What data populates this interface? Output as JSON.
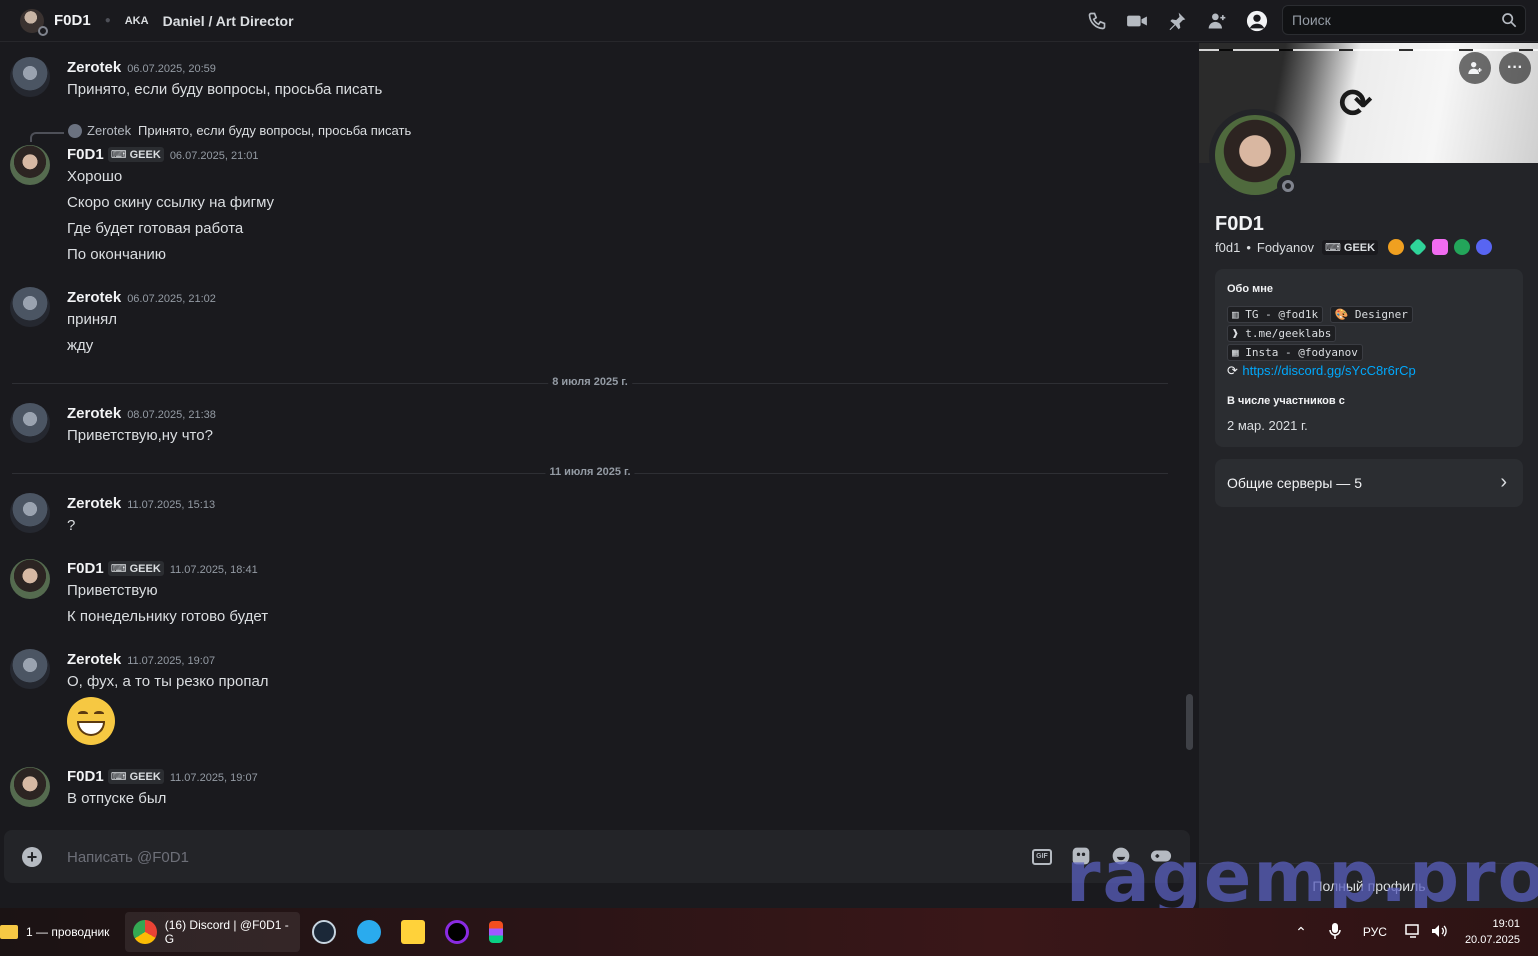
{
  "header": {
    "name": "F0D1",
    "aka": "AKA",
    "nickname": "Daniel / Art Director",
    "icons": [
      "phone-call-icon",
      "video-call-icon",
      "pin-icon",
      "add-friend-icon",
      "user-profile-icon"
    ],
    "search_placeholder": "Поиск"
  },
  "messages": [
    {
      "author": "Zerotek",
      "time": "06.07.2025, 20:59",
      "lines": [
        "Принято, если буду вопросы, просьба писать"
      ]
    },
    {
      "reply": {
        "author": "Zerotek",
        "text": "Принято, если буду вопросы, просьба писать"
      },
      "author": "F0D1",
      "tag": "GEEK",
      "time": "06.07.2025, 21:01",
      "lines": [
        "Хорошо",
        "Скоро скину ссылку на фигму",
        "Где будет готовая работа",
        "По окончанию"
      ]
    },
    {
      "author": "Zerotek",
      "time": "06.07.2025, 21:02",
      "lines": [
        "принял",
        "жду"
      ]
    },
    {
      "author": "Zerotek",
      "time": "08.07.2025, 21:38",
      "lines": [
        "Приветствую,ну что?"
      ]
    },
    {
      "author": "Zerotek",
      "time": "11.07.2025, 15:13",
      "lines": [
        "?"
      ]
    },
    {
      "author": "F0D1",
      "tag": "GEEK",
      "time": "11.07.2025, 18:41",
      "lines": [
        "Приветствую",
        "К понедельнику готово будет"
      ]
    },
    {
      "author": "Zerotek",
      "time": "11.07.2025, 19:07",
      "lines": [
        "О, фух, а то ты резко пропал"
      ],
      "emoji": "grinning-face-emoji"
    },
    {
      "author": "F0D1",
      "tag": "GEEK",
      "time": "11.07.2025, 19:07",
      "lines": [
        "В отпуске был"
      ]
    }
  ],
  "dividers": [
    "8 июля 2025 г.",
    "11 июля 2025 г."
  ],
  "composer": {
    "placeholder": "Написать @F0D1",
    "gif_label": "GIF"
  },
  "profile": {
    "name": "F0D1",
    "username": "f0d1",
    "display_name": "Fodyanov",
    "tag": "GEEK",
    "about_title": "Обо мне",
    "about": {
      "tg": "TG - @fod1k",
      "role": "Designer",
      "channel": "t.me/geeklabs",
      "insta": "Insta - @fodyanov",
      "link": "https://discord.gg/sYcC8r6rCp"
    },
    "member_since_title": "В числе участников с",
    "member_since": "2 мар. 2021 г.",
    "mutual_servers": "Общие серверы — 5",
    "full_profile": "Полный профиль",
    "badge_colors": [
      "#f0a020",
      "#2fd49a",
      "#f06cf0",
      "#23a55a",
      "#5865f2"
    ]
  },
  "watermark": "ragemp.pro",
  "taskbar": {
    "explorer": "1 — проводник",
    "chrome": "(16) Discord | @F0D1 - G",
    "lang": "РУС",
    "time": "19:01",
    "date": "20.07.2025"
  }
}
